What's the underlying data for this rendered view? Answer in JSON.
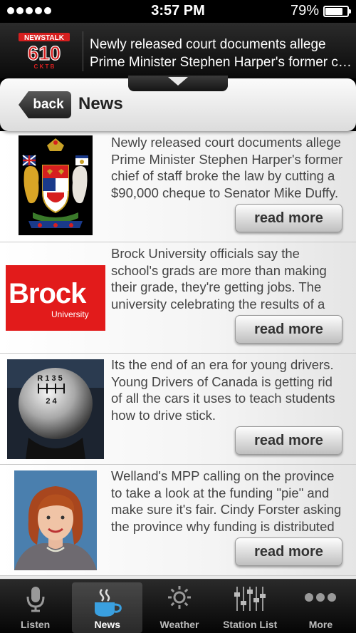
{
  "status_bar": {
    "time": "3:57 PM",
    "battery": "79%",
    "battery_level": 0.79
  },
  "now_playing": {
    "station_logo": {
      "line1": "NEWSTALK",
      "line2": "610",
      "line3": "C K T B"
    },
    "headline_line1": "Newly released court documents allege",
    "headline_line2": "Prime Minister Stephen Harper's former chief of staff"
  },
  "header": {
    "back_label": "back",
    "title": "News"
  },
  "news": [
    {
      "summary": "Newly released court documents allege Prime Minister Stephen Harper's former chief of staff broke the law by cutting a $90,000 cheque to Senator Mike Duffy.",
      "read_more": "read more",
      "image": "canada-coat-of-arms"
    },
    {
      "summary": "Brock University officials say the school's grads are more than making their grade, they're getting jobs. The university celebrating the results of a recent survey.",
      "read_more": "read more",
      "image": "brock-university-logo",
      "logo_text": "Brock",
      "logo_sub": "University"
    },
    {
      "summary": "Its the end of an era for young drivers. Young Drivers of Canada is getting rid of all the cars it uses to teach students how to drive stick.",
      "read_more": "read more",
      "image": "gear-shift-knob",
      "knob_row1": "R 1 3 5",
      "knob_row2": "2 4"
    },
    {
      "summary": "Welland's MPP calling on the province to take a look at the funding \"pie\" and make sure it's fair. Cindy Forster asking the province why funding is distributed the way it is.",
      "read_more": "read more",
      "image": "cindy-forster-portrait"
    }
  ],
  "tab_bar": [
    {
      "label": "Listen",
      "icon": "microphone-icon",
      "active": false
    },
    {
      "label": "News",
      "icon": "coffee-cup-icon",
      "active": true
    },
    {
      "label": "Weather",
      "icon": "sun-icon",
      "active": false
    },
    {
      "label": "Station List",
      "icon": "mixer-sliders-icon",
      "active": false
    },
    {
      "label": "More",
      "icon": "ellipsis-icon",
      "active": false
    }
  ],
  "colors": {
    "accent_red": "#d61f1f",
    "brock_red": "#e21b1b",
    "header_dark": "#111111",
    "tab_active": "#3aa0e0"
  }
}
